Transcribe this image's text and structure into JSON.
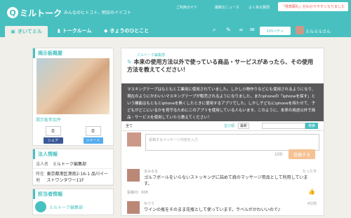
{
  "header": {
    "logo_text": "ミルトーク",
    "tagline": "みんなのヒトコト、明日のイイコト",
    "links": [
      "ご利用ガイド",
      "最新のニュース",
      "よくある質問"
    ],
    "cta": "「発表願礼」がわかりやすくなりました"
  },
  "nav": {
    "tabs": [
      "きいてミル",
      "トークルーム",
      "きょうのひとこと"
    ],
    "points": "105ペチャ",
    "user": "ミルミルさん"
  },
  "side": {
    "overview_title": "掲示板概要",
    "participants_label": "掲示板参加件",
    "share_count": "0",
    "tweet_count": "0",
    "share_label": "シェア",
    "tweet_label": "ツイート",
    "corp_title": "法人情報",
    "corp": [
      {
        "label": "法人名",
        "value": "ミルトーク編集部"
      },
      {
        "label": "所在地",
        "value": "東京都港区港南2-16-1 品川イーストワンタワー11F"
      }
    ],
    "staff_title": "担当者情報",
    "staff_name": "ミルトーク編集部"
  },
  "question": {
    "poster": "ミルトーク編集部",
    "title": "本来の使用方法以外で使っている商品・サービスがあったら、その使用方法を教えてください！",
    "body": "マスキングテープはもともと工業用に使用されていました。しかし小物作りなどにも使用されるようになり、現在のようにかわいいマスキングテープが販売されるようになりました。またiphoneの「iphoneを探す」という機能はもともとiphoneを無くしたときに使用するアプリでした。しかし子どもにiphoneを持たせて、子どもがどこにいるかを見守るためにこのアプリを使用している人もいます。このように、本来の用途以外で商品・サービスを使用していたら教えてください！"
  },
  "toolbar": {
    "all": "全て",
    "sort_label": "並び順",
    "sort_value": "最新",
    "search_btn": "検索"
  },
  "compose": {
    "placeholder": "投稿するメッセージ内容を入力",
    "count": "100",
    "post": "投稿する"
  },
  "comments": [
    {
      "name": "まみるる",
      "time": "たった今",
      "text": "ゴルフボールをいらないストッキングに詰めて肩のマッサージ用品として利用しています。",
      "likes": "投稿ID：608"
    },
    {
      "name": "ゆうり",
      "time": "4分前",
      "text": "ワインの瓶をそのまま花瓶として使っています。ラベルがかわいいので♪"
    }
  ]
}
